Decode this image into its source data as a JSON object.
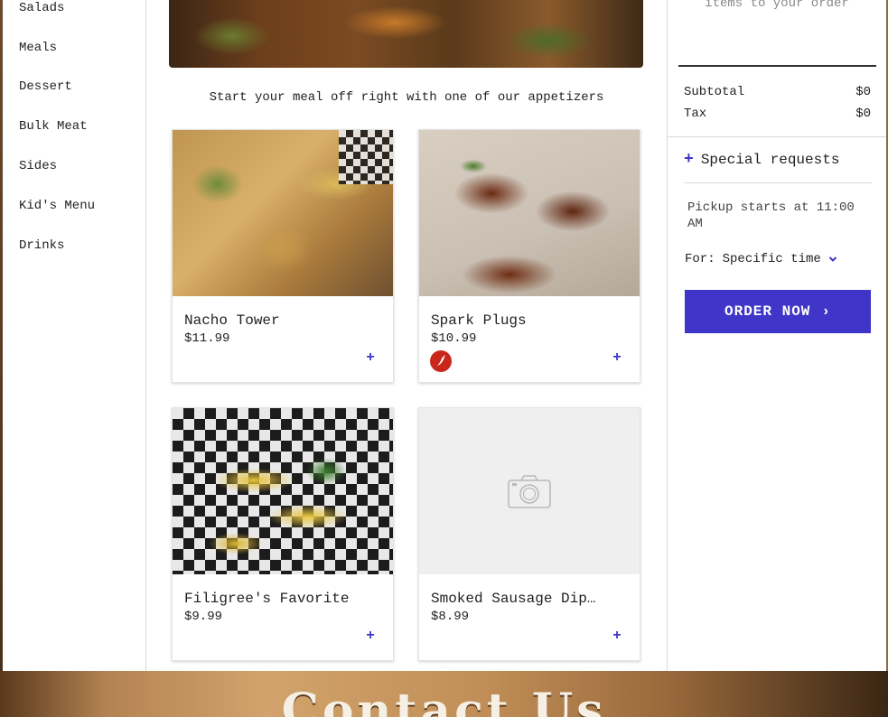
{
  "sidebar": {
    "items": [
      {
        "label": "Salads"
      },
      {
        "label": "Meals"
      },
      {
        "label": "Dessert"
      },
      {
        "label": "Bulk Meat"
      },
      {
        "label": "Sides"
      },
      {
        "label": "Kid's Menu"
      },
      {
        "label": "Drinks"
      }
    ]
  },
  "main": {
    "intro": "Start your meal off right with one of our appetizers",
    "items": [
      {
        "name": "Nacho Tower",
        "price": "$11.99",
        "add": "+",
        "spicy": false
      },
      {
        "name": "Spark Plugs",
        "price": "$10.99",
        "add": "+",
        "spicy": true
      },
      {
        "name": "Filigree's Favorite",
        "price": "$9.99",
        "add": "+",
        "spicy": false
      },
      {
        "name": "Smoked Sausage Dip…",
        "price": "$8.99",
        "add": "+",
        "spicy": false
      }
    ]
  },
  "cart": {
    "empty_text": "items to your order",
    "subtotal_label": "Subtotal",
    "subtotal_value": "$0",
    "tax_label": "Tax",
    "tax_value": "$0",
    "special_plus": "+",
    "special_label": "Special requests",
    "pickup_text": "Pickup starts at 11:00 AM",
    "for_label": "For:",
    "for_value": "Specific time",
    "order_label": "ORDER NOW",
    "order_arrow": "›"
  },
  "footer": {
    "title": "Contact Us"
  },
  "colors": {
    "accent": "#3f35c9",
    "spicy": "#c9271c"
  },
  "icons": {
    "spicy": "chili-pepper-icon",
    "placeholder": "camera-icon",
    "dropdown": "chevron-down-icon",
    "order_arrow": "chevron-right-icon"
  }
}
